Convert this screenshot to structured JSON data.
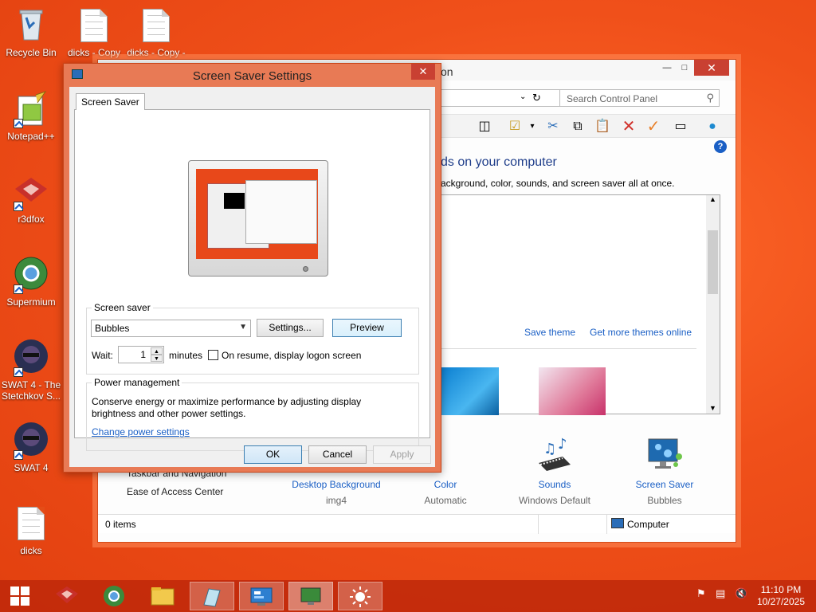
{
  "desktop": {
    "icons": [
      {
        "label": "Recycle Bin"
      },
      {
        "label": "dicks - Copy"
      },
      {
        "label": "dicks - Copy -"
      },
      {
        "label": "Notepad++"
      },
      {
        "label": "r3dfox"
      },
      {
        "label": "Supermium"
      },
      {
        "label": "SWAT 4 - The Stetchkov S..."
      },
      {
        "label": "SWAT 4"
      },
      {
        "label": "dicks"
      }
    ]
  },
  "control_panel": {
    "title_fragment": "on",
    "search_placeholder": "Search Control Panel",
    "heading": "ds on your computer",
    "subheading": "ackground, color, sounds, and screen saver all at once.",
    "save_theme": "Save theme",
    "more_themes": "Get more themes online",
    "see_also_1": "Taskbar and Navigation",
    "see_also_2": "Ease of Access Center",
    "bottom": [
      {
        "label": "Desktop Background",
        "value": "img4"
      },
      {
        "label": "Color",
        "value": "Automatic"
      },
      {
        "label": "Sounds",
        "value": "Windows Default"
      },
      {
        "label": "Screen Saver",
        "value": "Bubbles"
      }
    ],
    "status_items": "0 items",
    "status_location": "Computer"
  },
  "dialog": {
    "title": "Screen Saver Settings",
    "tab": "Screen Saver",
    "group_screensaver": "Screen saver",
    "selected_saver": "Bubbles",
    "settings_btn": "Settings...",
    "preview_btn": "Preview",
    "wait_label": "Wait:",
    "wait_value": "1",
    "minutes_label": "minutes",
    "resume_label": "On resume, display logon screen",
    "resume_checked": false,
    "group_power": "Power management",
    "power_text": "Conserve energy or maximize performance by adjusting display brightness and other power settings.",
    "power_link": "Change power settings",
    "ok": "OK",
    "cancel": "Cancel",
    "apply": "Apply"
  },
  "taskbar": {
    "time": "11:10 PM",
    "date": "10/27/2025"
  },
  "colors": {
    "desktop": "#f0501a",
    "dialog_frame": "#e87a55",
    "link": "#1a5fc5",
    "close_button": "#c94032"
  }
}
